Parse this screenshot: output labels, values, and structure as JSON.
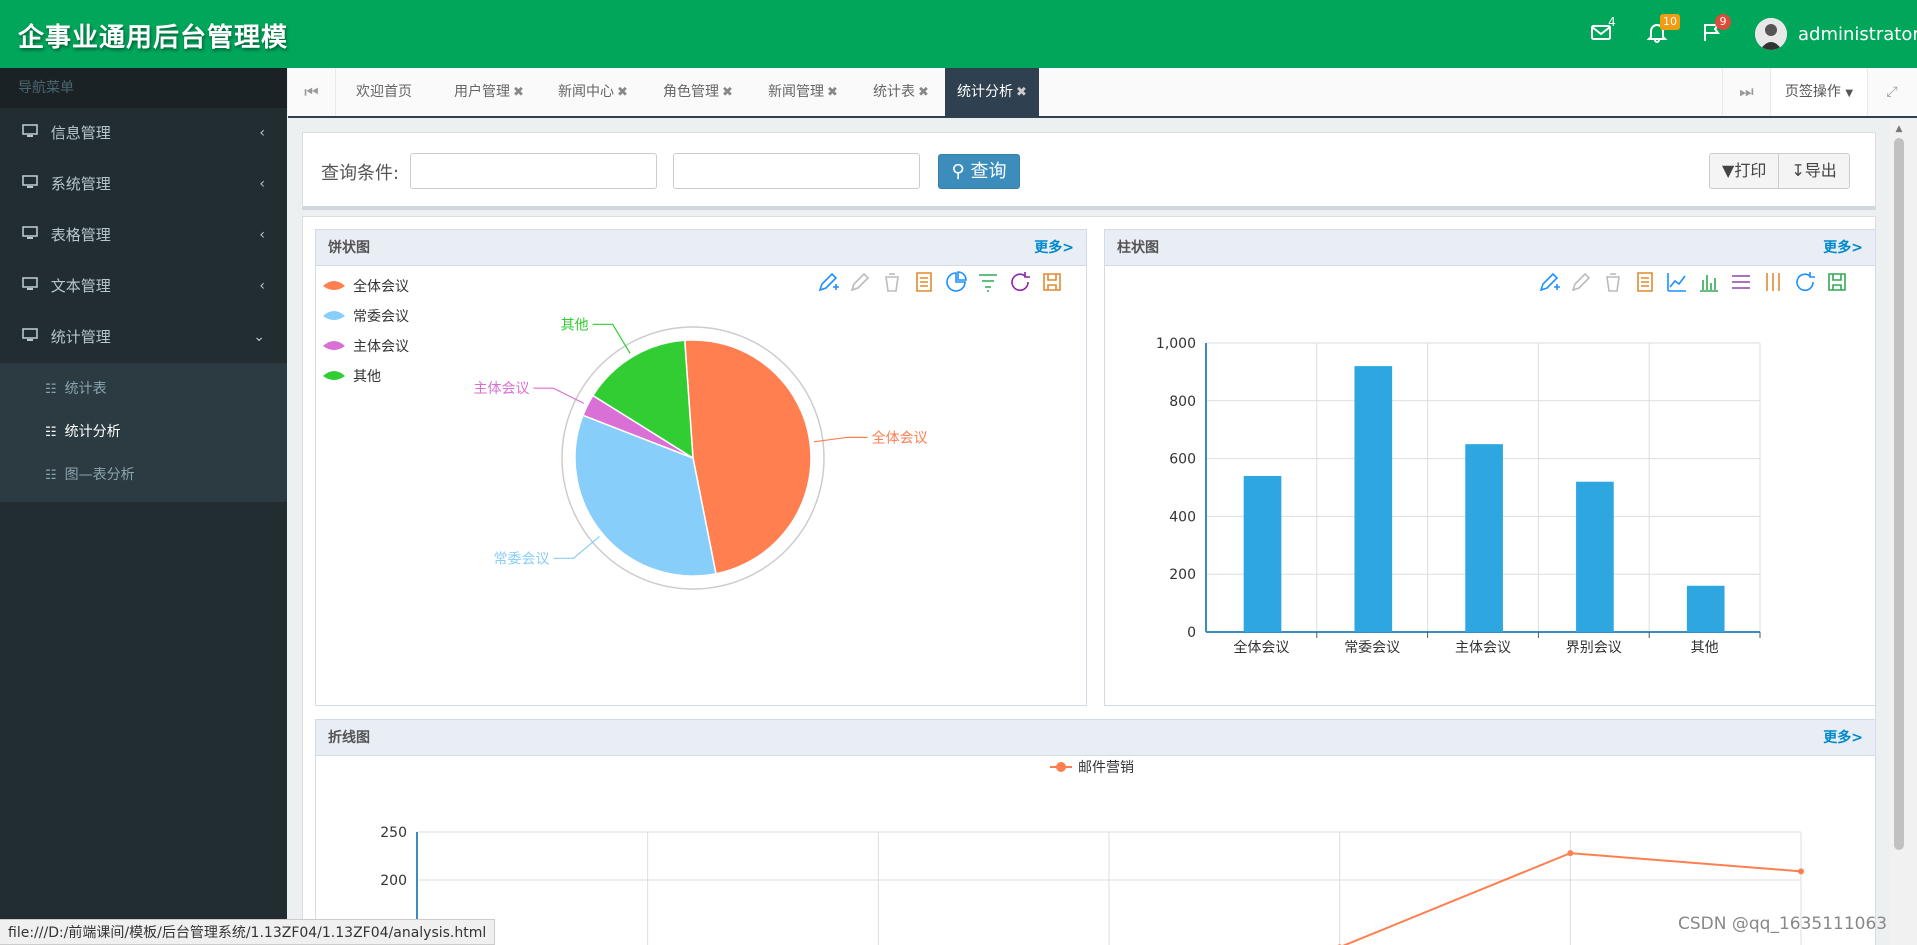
{
  "app": {
    "title": "企事业通用后台管理模"
  },
  "header": {
    "mail_count": "4",
    "bell_count": "10",
    "flag_count": "9",
    "user_name": "administrator"
  },
  "sidebar": {
    "nav_header": "导航菜单",
    "items": [
      {
        "label": "信息管理",
        "chevron": "‹"
      },
      {
        "label": "系统管理",
        "chevron": "‹"
      },
      {
        "label": "表格管理",
        "chevron": "‹"
      },
      {
        "label": "文本管理",
        "chevron": "‹"
      },
      {
        "label": "统计管理",
        "chevron": "⌄"
      }
    ],
    "subitems": [
      {
        "label": "统计表"
      },
      {
        "label": "统计分析"
      },
      {
        "label": "图—表分析"
      }
    ]
  },
  "tabs": {
    "items": [
      {
        "label": "欢迎首页",
        "close": ""
      },
      {
        "label": "用户管理",
        "close": "✖"
      },
      {
        "label": "新闻中心",
        "close": "✖"
      },
      {
        "label": "角色管理",
        "close": "✖"
      },
      {
        "label": "新闻管理",
        "close": "✖"
      },
      {
        "label": "统计表",
        "close": "✖"
      },
      {
        "label": "统计分析",
        "close": "✖"
      }
    ],
    "ops_label": "页签操作"
  },
  "query": {
    "label": "查询条件:",
    "input1_value": "",
    "input2_value": "",
    "search_label": "查询",
    "print_label": "打印",
    "export_label": "导出"
  },
  "panels": {
    "pie_title": "饼状图",
    "bar_title": "柱状图",
    "line_title": "折线图",
    "more_label": "更多>"
  },
  "footer": {
    "status_url": "file:///D:/前端课间/模板/后台管理系统/1.13ZF04/1.13ZF04/analysis.html",
    "watermark": "CSDN @qq_1635111063"
  },
  "icons": {
    "pie_toolbox": [
      "mark-pen-icon",
      "mark-undo-icon",
      "mark-clear-icon",
      "data-view-icon",
      "pie-type-icon",
      "funnel-type-icon",
      "restore-icon",
      "save-image-icon"
    ],
    "bar_toolbox": [
      "mark-pen-icon",
      "mark-undo-icon",
      "mark-clear-icon",
      "data-view-icon",
      "line-type-icon",
      "bar-type-icon",
      "stack-type-icon",
      "tiled-type-icon",
      "restore-icon",
      "save-image-icon"
    ]
  },
  "chart_data": [
    {
      "type": "pie",
      "legend": [
        "全体会议",
        "常委会议",
        "主体会议",
        "其他"
      ],
      "legend_position": "top-left",
      "values": [
        48,
        34,
        3,
        15
      ],
      "colors": [
        "#ff7f50",
        "#87cefa",
        "#da70d6",
        "#32cd32"
      ]
    },
    {
      "type": "bar",
      "categories": [
        "全体会议",
        "常委会议",
        "主体会议",
        "界别会议",
        "其他"
      ],
      "values": [
        540,
        920,
        650,
        520,
        160
      ],
      "ylim": [
        0,
        1000
      ],
      "yticks": [
        "0",
        "200",
        "400",
        "600",
        "800",
        "1,000"
      ],
      "color": "#2ea7e0",
      "grid": true
    },
    {
      "type": "line",
      "series": [
        {
          "name": "邮件营销",
          "values": [
            null,
            null,
            null,
            null,
            130,
            228,
            209
          ]
        }
      ],
      "ylim": [
        0,
        250
      ],
      "yticks": [
        "250",
        "200"
      ],
      "color": "#ff7f50",
      "grid": true,
      "legend_position": "top-center"
    }
  ]
}
